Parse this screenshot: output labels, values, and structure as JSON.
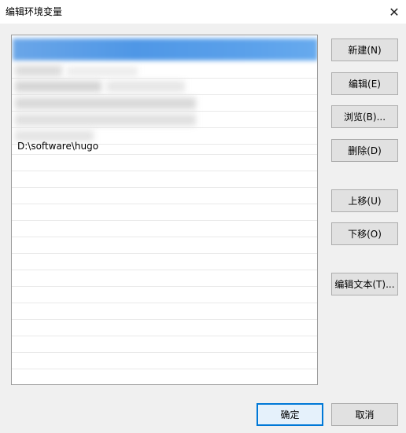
{
  "window": {
    "title": "编辑环境变量",
    "close_glyph": "✕"
  },
  "list": {
    "items": [
      "",
      "",
      "",
      "",
      "",
      "",
      "D:\\software\\hugo"
    ],
    "visible_item": "D:\\software\\hugo"
  },
  "buttons": {
    "new": "新建(N)",
    "edit": "编辑(E)",
    "browse": "浏览(B)...",
    "delete": "删除(D)",
    "move_up": "上移(U)",
    "move_down": "下移(O)",
    "edit_text": "编辑文本(T)...",
    "ok": "确定",
    "cancel": "取消"
  },
  "icons": {
    "close": "close-icon"
  },
  "colors": {
    "selection": "#3b8be6",
    "default_button_border": "#0078d7"
  }
}
